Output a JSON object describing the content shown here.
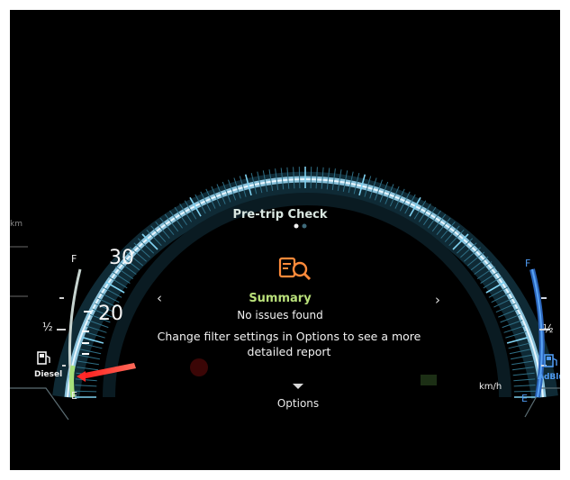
{
  "pretrip": {
    "title": "Pre-trip Check",
    "summary_label": "Summary",
    "status": "No issues found",
    "description_line1": "Change filter settings in Options to see a more",
    "description_line2": "detailed report",
    "options_label": "Options",
    "page_indicator": {
      "current": 1,
      "total": 2
    },
    "prev_arrow": "‹",
    "next_arrow": "›"
  },
  "left_gauge": {
    "speed_labels": [
      "30",
      "20"
    ],
    "full_label": "F",
    "half_label": "½",
    "empty_label": "E",
    "fuel_name": "Diesel",
    "left_unit": "km"
  },
  "right_gauge": {
    "full_label": "F",
    "half_label": "½",
    "empty_label": "E",
    "fluid_name": "AdBlue",
    "speed_unit": "km/h"
  },
  "colors": {
    "arc": "#bfe6ff",
    "arc_glow": "#3fa8d8",
    "summary": "#b9e07a",
    "warning_icon": "#ff8a3a",
    "needle": "#ff2a2a",
    "adblue": "#3a7fe0"
  },
  "icons": {
    "summary": "magnifier-document-icon",
    "fuel": "fuel-pump-icon",
    "adblue": "adblue-pump-icon"
  }
}
